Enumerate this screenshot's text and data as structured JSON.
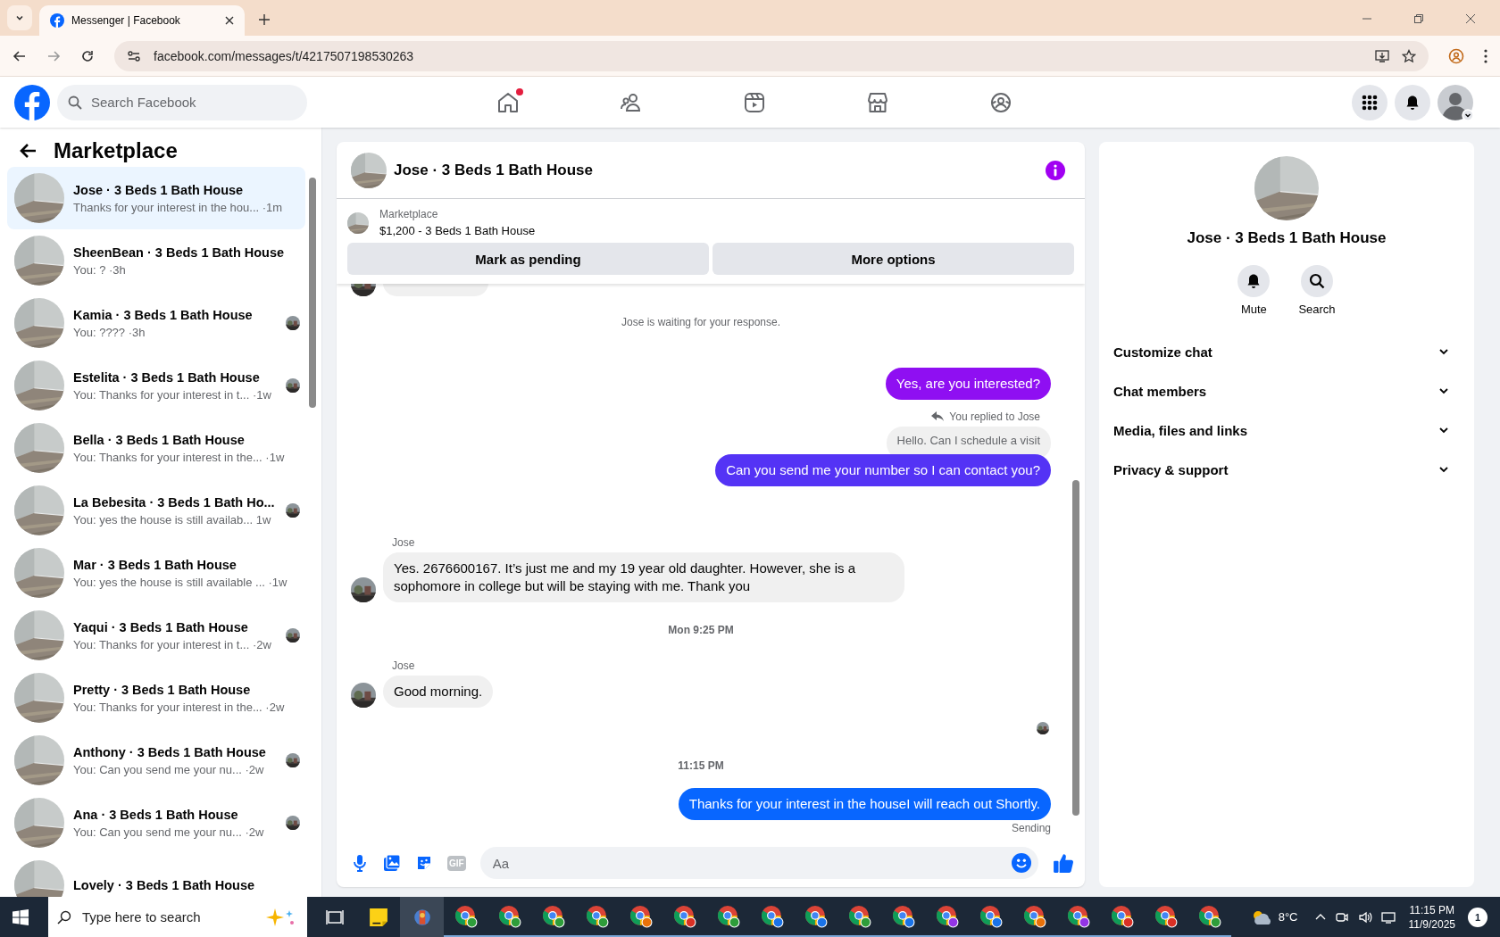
{
  "browser": {
    "tab_title": "Messenger | Facebook",
    "url": "facebook.com/messages/t/4217507198530263"
  },
  "header": {
    "search_placeholder": "Search Facebook",
    "nav": [
      {
        "kind": "home",
        "notification_dot": true
      },
      {
        "kind": "friends",
        "notification_dot": false
      },
      {
        "kind": "video",
        "notification_dot": false
      },
      {
        "kind": "marketplace",
        "notification_dot": false
      },
      {
        "kind": "groups",
        "notification_dot": false
      }
    ]
  },
  "sidebar": {
    "title": "Marketplace",
    "conversations": [
      {
        "name": "Jose · 3 Beds 1 Bath House",
        "preview": "Thanks for your interest in the hou...",
        "time": "·1m",
        "selected": true,
        "seen_avatar": false
      },
      {
        "name": "SheenBean · 3 Beds 1 Bath House",
        "preview": "You: ?",
        "time": "·3h",
        "selected": false,
        "seen_avatar": false
      },
      {
        "name": "Kamia · 3 Beds 1 Bath House",
        "preview": "You: ????",
        "time": "·3h",
        "selected": false,
        "seen_avatar": true
      },
      {
        "name": "Estelita · 3 Beds 1 Bath House",
        "preview": "You: Thanks for your interest in t...",
        "time": "·1w",
        "selected": false,
        "seen_avatar": true
      },
      {
        "name": "Bella · 3 Beds 1 Bath House",
        "preview": "You: Thanks for your interest in the...",
        "time": "·1w",
        "selected": false,
        "seen_avatar": false
      },
      {
        "name": "La Bebesita · 3 Beds 1 Bath Ho...",
        "preview": "You: yes the house is still availab...",
        "time": "1w",
        "selected": false,
        "seen_avatar": true
      },
      {
        "name": "Mar · 3 Beds 1 Bath House",
        "preview": "You: yes the house is still available ...",
        "time": "·1w",
        "selected": false,
        "seen_avatar": false
      },
      {
        "name": "Yaqui · 3 Beds 1 Bath House",
        "preview": "You: Thanks for your interest in t...",
        "time": "·2w",
        "selected": false,
        "seen_avatar": true
      },
      {
        "name": "Pretty · 3 Beds 1 Bath House",
        "preview": "You: Thanks for your interest in the...",
        "time": "·2w",
        "selected": false,
        "seen_avatar": false
      },
      {
        "name": "Anthony · 3 Beds 1 Bath House",
        "preview": "You: Can you send me your nu...",
        "time": "·2w",
        "selected": false,
        "seen_avatar": true
      },
      {
        "name": "Ana · 3 Beds 1 Bath House",
        "preview": "You: Can you send me your nu...",
        "time": "·2w",
        "selected": false,
        "seen_avatar": true
      },
      {
        "name": "Lovely · 3 Beds 1 Bath House",
        "selected": false,
        "seen_avatar": false
      }
    ]
  },
  "chat": {
    "title": "Jose · 3 Beds 1 Bath House",
    "listing": {
      "label": "Marketplace",
      "title": "$1,200 - 3 Beds 1 Bath House"
    },
    "buttons": [
      "Mark as pending",
      "More options"
    ],
    "messages": [
      {
        "kind": "cut"
      },
      {
        "kind": "status",
        "text": "Jose is waiting for your response."
      },
      {
        "kind": "out",
        "text": "Yes, are you interested?",
        "color": "#8f0ff2"
      },
      {
        "kind": "reply_note",
        "text": "You replied to Jose"
      },
      {
        "kind": "quote",
        "text": "Hello. Can I schedule a visit"
      },
      {
        "kind": "out",
        "text": "Can you send me your number so I can contact you?",
        "color": "#5433f5"
      },
      {
        "kind": "sender",
        "text": "Jose"
      },
      {
        "kind": "in",
        "text": "Yes. 2676600167. It’s just me and my 19 year old daughter. However, she is a sophomore in college but will be staying with me. Thank you"
      },
      {
        "kind": "time",
        "text": "Mon 9:25 PM"
      },
      {
        "kind": "sender",
        "text": "Jose"
      },
      {
        "kind": "in",
        "text": "Good morning."
      },
      {
        "kind": "seen"
      },
      {
        "kind": "time",
        "text": "11:15 PM"
      },
      {
        "kind": "out",
        "text": "Thanks for your interest in the houseI will reach out Shortly.",
        "color": "#0866ff"
      },
      {
        "kind": "sending",
        "text": "Sending"
      }
    ],
    "composer": {
      "placeholder": "Aa",
      "gif_label": "GIF"
    }
  },
  "details": {
    "name": "Jose · 3 Beds 1 Bath House",
    "actions": [
      {
        "kind": "bell",
        "label": "Mute"
      },
      {
        "kind": "search",
        "label": "Search"
      }
    ],
    "sections": [
      "Customize chat",
      "Chat members",
      "Media, files and links",
      "Privacy & support"
    ]
  },
  "taskbar": {
    "search_placeholder": "Type here to search",
    "apps": [
      {
        "kind": "taskview"
      },
      {
        "kind": "notes"
      },
      {
        "kind": "tool"
      },
      {
        "kind": "chrome",
        "color": "#2e9d3a"
      },
      {
        "kind": "chrome",
        "color": "#2e9d3a"
      },
      {
        "kind": "chrome",
        "color": "#2e9d3a"
      },
      {
        "kind": "chrome",
        "color": "#2e9d3a"
      },
      {
        "kind": "chrome",
        "color": "#e8710a"
      },
      {
        "kind": "chrome",
        "color": "#d93025"
      },
      {
        "kind": "chrome",
        "color": "#2e9d3a"
      },
      {
        "kind": "chrome",
        "color": "#1a73e8"
      },
      {
        "kind": "chrome",
        "color": "#1a73e8"
      },
      {
        "kind": "chrome",
        "color": "#2e9d3a"
      },
      {
        "kind": "chrome",
        "color": "#1a73e8"
      },
      {
        "kind": "chrome",
        "color": "#9334e6"
      },
      {
        "kind": "chrome",
        "color": "#1a73e8"
      },
      {
        "kind": "chrome",
        "color": "#e8710a"
      },
      {
        "kind": "chrome",
        "color": "#9334e6"
      },
      {
        "kind": "chrome",
        "color": "#d93025"
      },
      {
        "kind": "chrome",
        "color": "#d93025"
      },
      {
        "kind": "chrome",
        "color": "#2e9d3a"
      }
    ],
    "temperature": "8°C",
    "time": "11:15 PM",
    "date": "11/9/2025",
    "notifications": "1"
  }
}
